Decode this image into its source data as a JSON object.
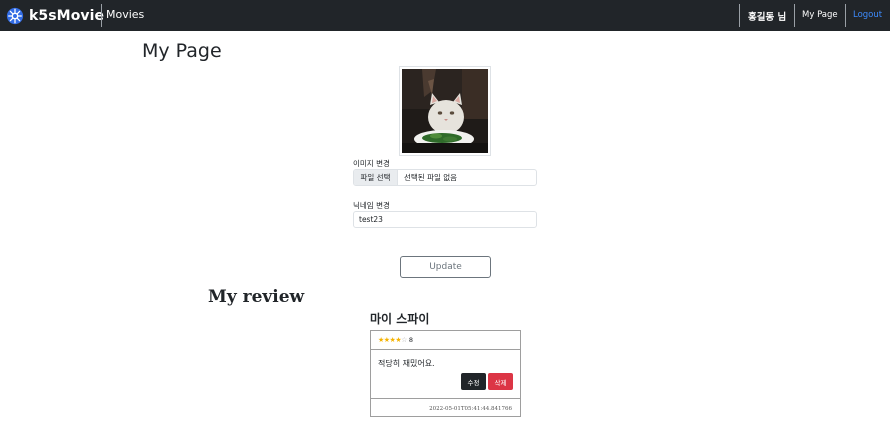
{
  "navbar": {
    "brand": "k5sMovie",
    "movies_link": "Movies",
    "user_greeting": "홍길동 님",
    "mypage_link": "My Page",
    "logout_link": "Logout",
    "logout_color": "#3d8bfd",
    "background_color": "#212529"
  },
  "page": {
    "title": "My Page"
  },
  "profile": {
    "avatar_icon": "cat-photo"
  },
  "form": {
    "image_label": "이미지 변경",
    "file_button": "파일 선택",
    "file_status": "선택된 파일 없음",
    "nickname_label": "닉네임 변경",
    "nickname_value": "test23",
    "update_button": "Update"
  },
  "reviews": {
    "section_title": "My review",
    "items": [
      {
        "movie_title": "마이 스파이",
        "stars_filled": "★★★★",
        "stars_empty": "☆",
        "rating": "8",
        "text": "적당히 재밌어요.",
        "edit_label": "수정",
        "delete_label": "삭제",
        "timestamp": "2022-05-01T05:41:44.841766"
      }
    ]
  }
}
